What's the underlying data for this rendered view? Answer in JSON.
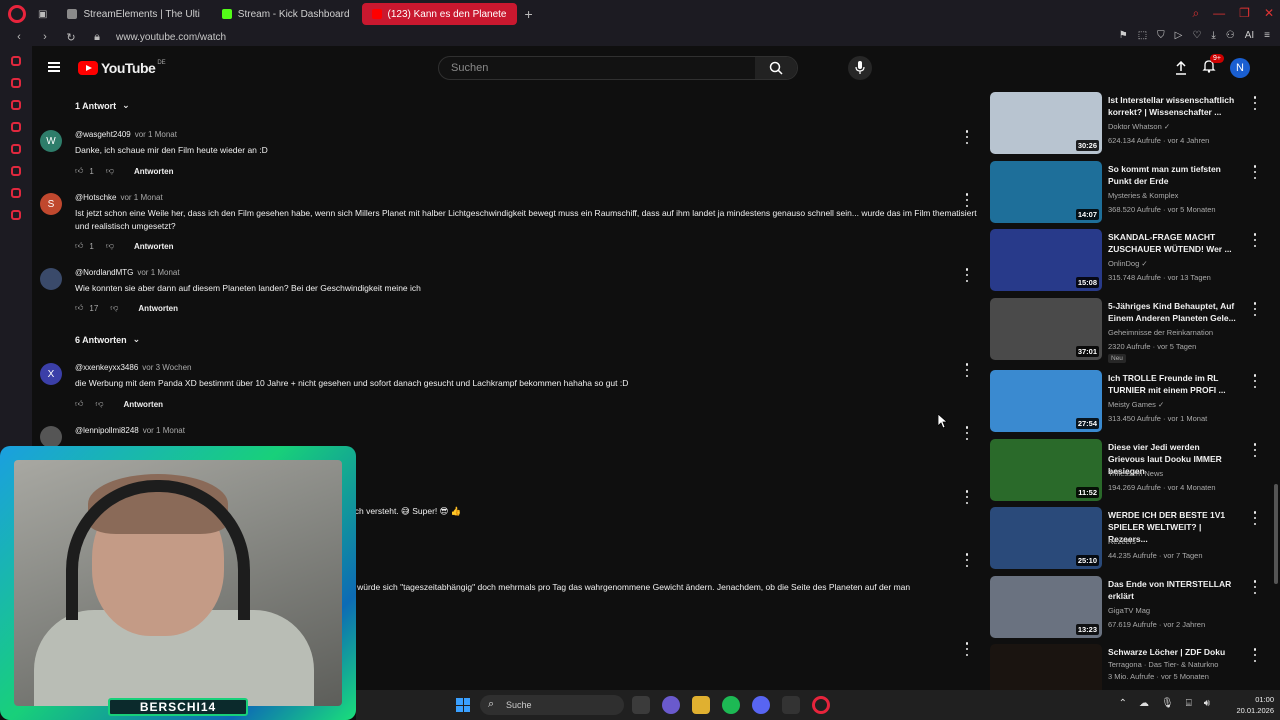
{
  "browser": {
    "tabs": [
      {
        "label": "StreamElements | The Ulti",
        "color": "#8a8a8a",
        "active": false
      },
      {
        "label": "Stream - Kick Dashboard",
        "color": "#53fc18",
        "active": false
      },
      {
        "label": "(123) Kann es den Planete",
        "color": "#ff0000",
        "active": true
      }
    ],
    "url": "www.youtube.com/watch"
  },
  "header": {
    "logo_text": "YouTube",
    "region": "DE",
    "search_placeholder": "Suchen",
    "notifications": "9+",
    "avatar_letter": "N"
  },
  "comments": {
    "toggle_1": "1 Antwort",
    "toggle_2": "6 Antworten",
    "reply_label": "Antworten",
    "items": [
      {
        "user": "@wasgeht2409",
        "time": "vor 1 Monat",
        "text": "Danke, ich schaue mir den Film heute wieder an :D",
        "likes": "1",
        "initial": "W",
        "color": "#2e7d6a"
      },
      {
        "user": "@Hotschke",
        "time": "vor 1 Monat",
        "text": "Ist jetzt schon eine Weile her, dass ich den Film gesehen habe, wenn sich Millers Planet mit halber Lichtgeschwindigkeit bewegt muss ein Raumschiff, dass auf ihm landet ja mindestens genauso schnell sein... wurde das im Film thematisiert und realistisch umgesetzt?",
        "likes": "1",
        "initial": "S",
        "color": "#c0482e"
      },
      {
        "user": "@NordlandMTG",
        "time": "vor 1 Monat",
        "text": "Wie konnten sie aber dann auf diesem Planeten landen? Bei der Geschwindigkeit meine ich",
        "likes": "17",
        "initial": "",
        "color": "#3a4a6a"
      },
      {
        "user": "@xxenkeyxx3486",
        "time": "vor 3 Wochen",
        "text": "die Werbung mit dem Panda XD bestimmt über 10 Jahre + nicht gesehen und sofort danach gesucht und Lachkrampf bekommen hahaha so gut :D",
        "likes": "",
        "initial": "X",
        "color": "#3b3fa8"
      },
      {
        "user": "@lennipollmi8248",
        "time": "vor 1 Monat",
        "text": "",
        "likes": "",
        "initial": "",
        "color": "#555"
      }
    ],
    "partial_1": "uch versteht. 😅 Super! 😎 👍",
    "partial_2": "n würde sich \"tageszeitabhängig\" doch mehrmals pro Tag das wahrgenommene Gewicht ändern. Jenachdem, ob die Seite des Planeten auf der man"
  },
  "recommendations": [
    {
      "title": "Ist Interstellar wissenschaftlich korrekt? | Wissenschafter ...",
      "channel": "Doktor Whatson",
      "meta": "624.134 Aufrufe · vor 4 Jahren",
      "duration": "30:26",
      "verified": true,
      "thumb": "#b8c4d0",
      "new": ""
    },
    {
      "title": "So kommt man zum tiefsten Punkt der Erde",
      "channel": "Mysteries & Komplex",
      "meta": "368.520 Aufrufe · vor 5 Monaten",
      "duration": "14:07",
      "verified": false,
      "thumb": "#1e6f9a",
      "new": ""
    },
    {
      "title": "SKANDAL-FRAGE MACHT ZUSCHAUER WÜTEND! Wer ...",
      "channel": "OnlinDog",
      "meta": "315.748 Aufrufe · vor 13 Tagen",
      "duration": "15:08",
      "verified": true,
      "thumb": "#283a8a",
      "new": ""
    },
    {
      "title": "5-Jähriges Kind Behauptet, Auf Einem Anderen Planeten Gele...",
      "channel": "Geheimnisse der Reinkarnation",
      "meta": "2320 Aufrufe · vor 5 Tagen",
      "duration": "37:01",
      "verified": false,
      "thumb": "#4a4a4a",
      "new": "Neu"
    },
    {
      "title": "Ich TROLLE Freunde im RL TURNIER mit einem PROFI ...",
      "channel": "Meisty Games",
      "meta": "313.450 Aufrufe · vor 1 Monat",
      "duration": "27:54",
      "verified": true,
      "thumb": "#3a8ad0",
      "new": ""
    },
    {
      "title": "Diese vier Jedi werden Grievous laut Dooku IMMER besiegen",
      "channel": "Trifiessem News",
      "meta": "194.269 Aufrufe · vor 4 Monaten",
      "duration": "11:52",
      "verified": false,
      "thumb": "#2a6a2a",
      "new": ""
    },
    {
      "title": "WERDE ICH DER BESTE 1V1 SPIELER WELTWEIT? | Rezeers...",
      "channel": "Rezeers",
      "meta": "44.235 Aufrufe · vor 7 Tagen",
      "duration": "25:10",
      "verified": false,
      "thumb": "#2a4a7a",
      "new": ""
    },
    {
      "title": "Das Ende von INTERSTELLAR erklärt",
      "channel": "GigaTV Mag",
      "meta": "67.619 Aufrufe · vor 2 Jahren",
      "duration": "13:23",
      "verified": false,
      "thumb": "#6a7280",
      "new": ""
    },
    {
      "title": "Schwarze Löcher | ZDF Doku",
      "channel": "Terragona · Das Tier- & Naturkno",
      "meta": "3 Mio. Aufrufe · vor 5 Monaten",
      "duration": "",
      "verified": false,
      "thumb": "#1a1410",
      "new": ""
    }
  ],
  "webcam": {
    "name": "BERSCHI14"
  },
  "taskbar": {
    "search": "Suche",
    "time": "01:00",
    "date": "20.01.2026"
  }
}
